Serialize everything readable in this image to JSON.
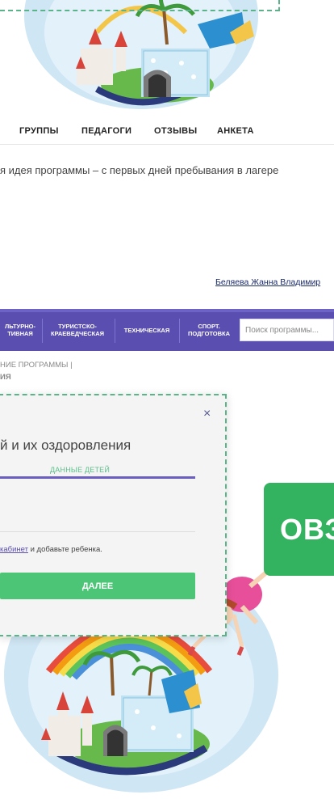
{
  "nav": {
    "items": [
      "ГРУППЫ",
      "ПЕДАГОГИ",
      "ОТЗЫВЫ",
      "АНКЕТА"
    ]
  },
  "intro_text": "я идея программы – с первых дней пребывания в лагере",
  "author": "Беляева Жанна Владимир",
  "categories": [
    {
      "line1": "ЛЬТУРНО-",
      "line2": "ТИВНАЯ"
    },
    {
      "line1": "ТУРИСТСКО-",
      "line2": "КРАЕВЕДЧЕСКАЯ"
    },
    {
      "line1": "ТЕХНИЧЕСКАЯ",
      "line2": ""
    },
    {
      "line1": "СПОРТ.",
      "line2": "ПОДГОТОВКА"
    }
  ],
  "search": {
    "placeholder": "Поиск программы..."
  },
  "breadcrumb": {
    "line1": "НИЕ ПРОГРАММЫ  |",
    "line2": "ИЯ"
  },
  "modal": {
    "close": "×",
    "title": "й и их оздоровления",
    "step_label": "ДАННЫЕ ДЕТЕЙ",
    "cabinet_link": "кабинет",
    "cabinet_rest": " и добавьте ребенка.",
    "next_button": "ДАЛЕЕ"
  },
  "badge": {
    "text": "ОВЗ"
  },
  "colors": {
    "purple": "#5a4fb0",
    "green": "#4cc676",
    "badge_green": "#33b35f"
  }
}
